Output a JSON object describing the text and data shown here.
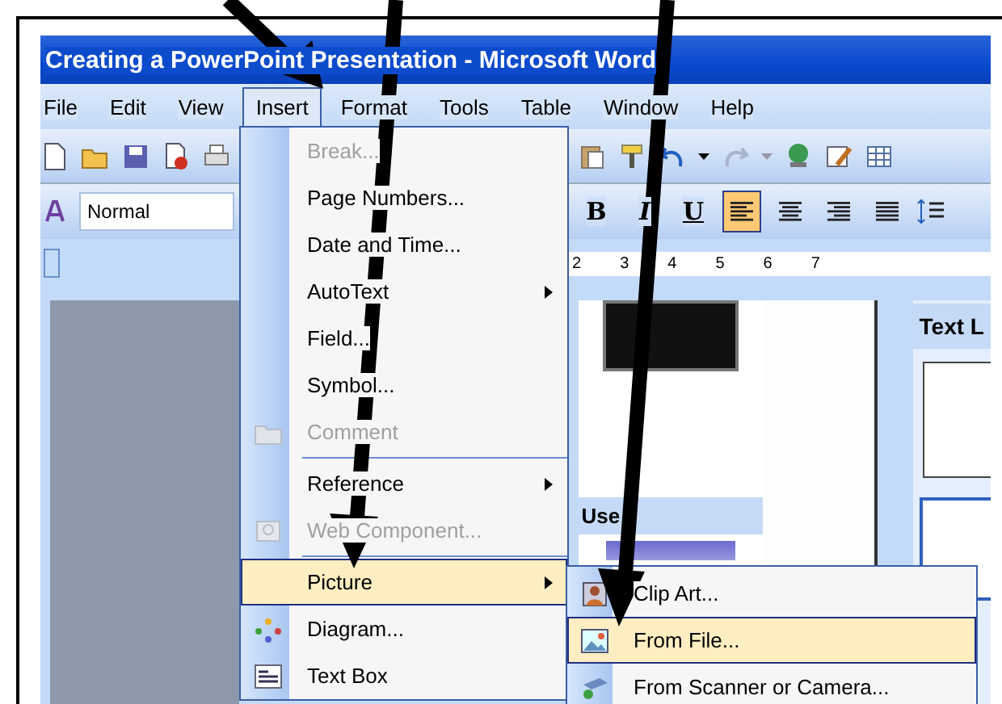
{
  "window": {
    "title": "Creating a PowerPoint Presentation - Microsoft Word"
  },
  "menu_bar": [
    {
      "label": "File",
      "selected": false
    },
    {
      "label": "Edit",
      "selected": false
    },
    {
      "label": "View",
      "selected": false
    },
    {
      "label": "Insert",
      "selected": true
    },
    {
      "label": "Format",
      "selected": false
    },
    {
      "label": "Tools",
      "selected": false
    },
    {
      "label": "Table",
      "selected": false
    },
    {
      "label": "Window",
      "selected": false
    },
    {
      "label": "Help",
      "selected": false
    }
  ],
  "formatting_toolbar": {
    "style": "Normal",
    "buttons": [
      {
        "kind": "bold",
        "label": "B",
        "selected": false
      },
      {
        "kind": "italic",
        "label": "I",
        "selected": false
      },
      {
        "kind": "underline",
        "label": "U",
        "selected": false
      },
      {
        "kind": "align-left",
        "selected": true
      },
      {
        "kind": "align-center",
        "selected": false
      },
      {
        "kind": "align-right",
        "selected": false
      },
      {
        "kind": "justify",
        "selected": false
      }
    ]
  },
  "ruler": {
    "numbers": [
      "2",
      "3",
      "4",
      "5",
      "6",
      "7"
    ]
  },
  "slides_pane": {
    "section_header": "Use"
  },
  "task_pane": {
    "heading": "Text L"
  },
  "insert_menu": [
    {
      "label": "Break...",
      "disabled": true,
      "has_submenu": false,
      "selected": false,
      "separator_before": false
    },
    {
      "label": "Page Numbers...",
      "disabled": false,
      "has_submenu": false,
      "selected": false,
      "separator_before": false
    },
    {
      "label": "Date and Time...",
      "disabled": false,
      "has_submenu": false,
      "selected": false,
      "separator_before": false
    },
    {
      "label": "AutoText",
      "disabled": false,
      "has_submenu": true,
      "selected": false,
      "separator_before": false
    },
    {
      "label": "Field...",
      "disabled": false,
      "has_submenu": false,
      "selected": false,
      "separator_before": false
    },
    {
      "label": "Symbol...",
      "disabled": false,
      "has_submenu": false,
      "selected": false,
      "separator_before": false
    },
    {
      "label": "Comment",
      "disabled": true,
      "has_submenu": false,
      "selected": false,
      "separator_before": false
    },
    {
      "label": "Reference",
      "disabled": false,
      "has_submenu": true,
      "selected": false,
      "separator_before": true
    },
    {
      "label": "Web Component...",
      "disabled": true,
      "has_submenu": false,
      "selected": false,
      "separator_before": false
    },
    {
      "label": "Picture",
      "disabled": false,
      "has_submenu": true,
      "selected": true,
      "separator_before": true
    },
    {
      "label": "Diagram...",
      "disabled": false,
      "has_submenu": false,
      "selected": false,
      "separator_before": false
    },
    {
      "label": "Text Box",
      "disabled": false,
      "has_submenu": false,
      "selected": false,
      "separator_before": false
    }
  ],
  "picture_submenu": [
    {
      "label": "Clip Art...",
      "selected": false
    },
    {
      "label": "From File...",
      "selected": true
    },
    {
      "label": "From Scanner or Camera...",
      "selected": false
    }
  ]
}
